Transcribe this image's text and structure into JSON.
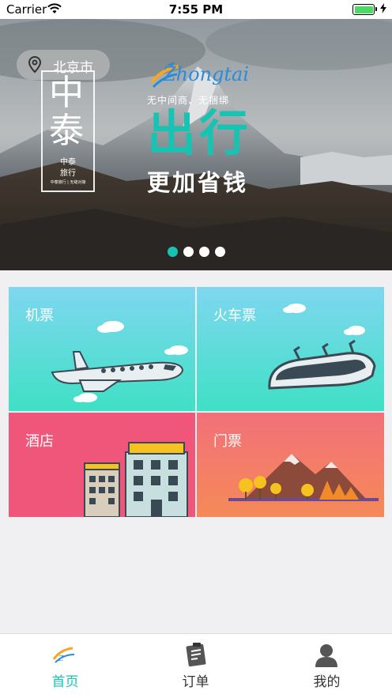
{
  "status_bar": {
    "carrier": "Carrier",
    "time": "7:55 PM"
  },
  "banner": {
    "city": "北京市",
    "logo_big_1": "中",
    "logo_big_2": "泰",
    "logo_small": "中泰\n旅行",
    "logo_tiny": "中泰旅行 | 无缝对接",
    "brand_word": "Zhongtai",
    "slogan": "无中间商、无捆绑",
    "headline": "出行",
    "subheadline": "更加省钱",
    "page_count": 4,
    "active_page": 1,
    "accent": "#17c3b2"
  },
  "services": [
    {
      "label": "机票",
      "icon": "airplane-icon",
      "color": "#5fd6e0"
    },
    {
      "label": "火车票",
      "icon": "train-icon",
      "color": "#5fd6e0"
    },
    {
      "label": "酒店",
      "icon": "hotel-icon",
      "color": "#f0567a"
    },
    {
      "label": "门票",
      "icon": "mountain-icon",
      "color": "#f37a5e"
    }
  ],
  "tabbar": {
    "tabs": [
      {
        "label": "首页",
        "icon": "home-logo-icon",
        "active": true
      },
      {
        "label": "订单",
        "icon": "orders-icon",
        "active": false
      },
      {
        "label": "我的",
        "icon": "profile-icon",
        "active": false
      }
    ],
    "active_color": "#17c3b2",
    "inactive_color": "#333333"
  }
}
